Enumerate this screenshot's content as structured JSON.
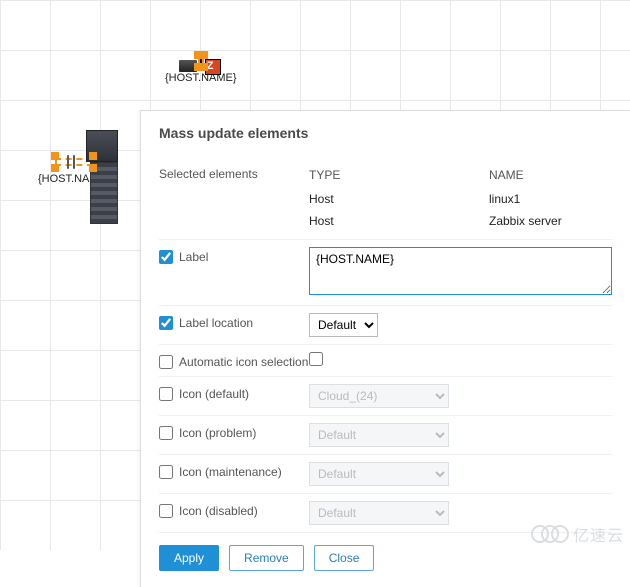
{
  "canvas": {
    "el_top": {
      "label": "{HOST.NAME}",
      "icon_name": "rack-switch-icon"
    },
    "el_left": {
      "label": "{HOST.NAME}",
      "icon_name": "server-tower-icon"
    }
  },
  "dialog": {
    "title": "Mass update elements",
    "selected_label": "Selected elements",
    "table": {
      "headers": {
        "type": "TYPE",
        "name": "NAME"
      },
      "rows": [
        {
          "type": "Host",
          "name": "linux1"
        },
        {
          "type": "Host",
          "name": "Zabbix server"
        }
      ]
    },
    "fields": {
      "label": {
        "title": "Label",
        "checked": true,
        "value": "{HOST.NAME}"
      },
      "label_location": {
        "title": "Label location",
        "checked": true,
        "value": "Default"
      },
      "auto_icon": {
        "title": "Automatic icon selection",
        "checked": false,
        "value_checked": false
      },
      "icon_default": {
        "title": "Icon (default)",
        "checked": false,
        "value": "Cloud_(24)"
      },
      "icon_problem": {
        "title": "Icon (problem)",
        "checked": false,
        "value": "Default"
      },
      "icon_maintenance": {
        "title": "Icon (maintenance)",
        "checked": false,
        "value": "Default"
      },
      "icon_disabled": {
        "title": "Icon (disabled)",
        "checked": false,
        "value": "Default"
      }
    },
    "buttons": {
      "apply": "Apply",
      "remove": "Remove",
      "close": "Close"
    }
  },
  "watermark": "亿速云"
}
